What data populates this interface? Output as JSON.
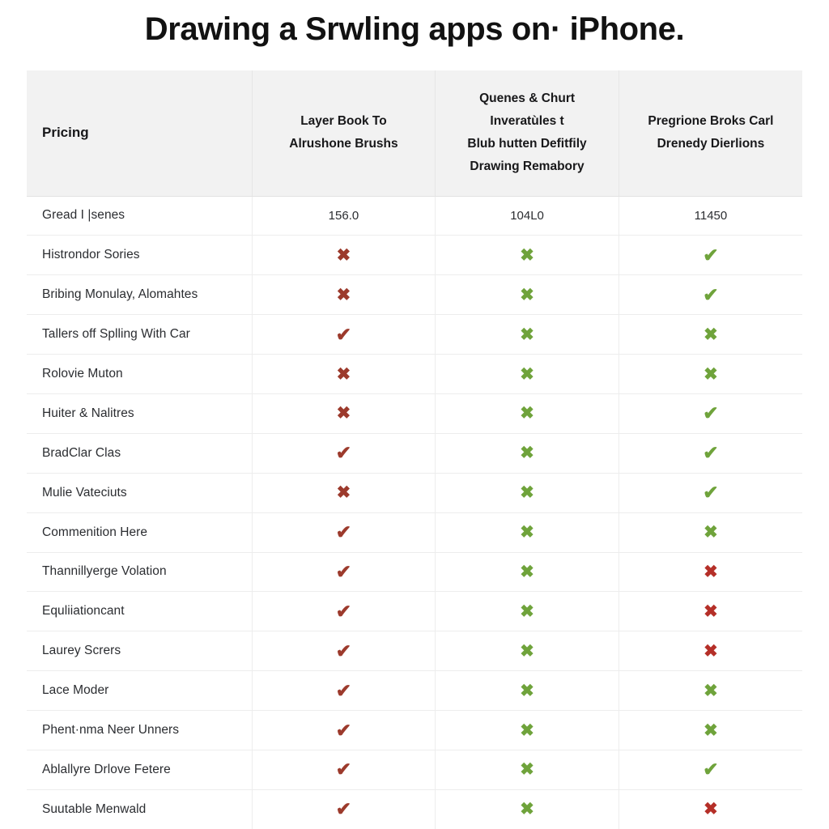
{
  "page": {
    "title": "Drawing a Srwling apps on· iPhone.",
    "background_color": "#ffffff"
  },
  "colors": {
    "header_background": "#f2f2f2",
    "row_border": "#ededed",
    "text": "#24262a",
    "mark_dark_red": "#9c3a2c",
    "mark_bright_red": "#b52f28",
    "mark_green": "#6fa33b"
  },
  "table": {
    "headers": {
      "feature_column": "Pricing",
      "columns": [
        {
          "lines": [
            "Layer Book To",
            "Alrushone Brushs"
          ]
        },
        {
          "lines": [
            "Quenes & Churt",
            "Inveratùles t",
            "Blub hutten Defitfily",
            "Drawing Remabory"
          ]
        },
        {
          "lines": [
            "Pregrione Broks Carl",
            "Drenedy Dierlions"
          ]
        }
      ]
    },
    "rows": [
      {
        "label": "Gread I |senes",
        "cells": [
          {
            "type": "value",
            "text": "156.0"
          },
          {
            "type": "value",
            "text": "104L0"
          },
          {
            "type": "value",
            "text": "11450"
          }
        ]
      },
      {
        "label": "Histrondor Sories",
        "cells": [
          {
            "type": "cross",
            "glyph": "✖",
            "color": "dark-red"
          },
          {
            "type": "cross",
            "glyph": "✖",
            "color": "green"
          },
          {
            "type": "check",
            "glyph": "✔",
            "color": "green"
          }
        ]
      },
      {
        "label": "Bribing Monulay, Alomahtes",
        "cells": [
          {
            "type": "cross",
            "glyph": "✖",
            "color": "dark-red"
          },
          {
            "type": "cross",
            "glyph": "✖",
            "color": "green"
          },
          {
            "type": "check",
            "glyph": "✔",
            "color": "green"
          }
        ]
      },
      {
        "label": "Tallers off Splling With Car",
        "cells": [
          {
            "type": "check",
            "glyph": "✔",
            "color": "dark-red"
          },
          {
            "type": "cross",
            "glyph": "✖",
            "color": "green"
          },
          {
            "type": "cross",
            "glyph": "✖",
            "color": "green"
          }
        ]
      },
      {
        "label": "Rolovie Muton",
        "cells": [
          {
            "type": "cross",
            "glyph": "✖",
            "color": "dark-red"
          },
          {
            "type": "cross",
            "glyph": "✖",
            "color": "green"
          },
          {
            "type": "cross",
            "glyph": "✖",
            "color": "green"
          }
        ]
      },
      {
        "label": "Huiter & Nalitres",
        "cells": [
          {
            "type": "cross",
            "glyph": "✖",
            "color": "dark-red"
          },
          {
            "type": "cross",
            "glyph": "✖",
            "color": "green"
          },
          {
            "type": "check",
            "glyph": "✔",
            "color": "green"
          }
        ]
      },
      {
        "label": "BradClar Clas",
        "cells": [
          {
            "type": "check",
            "glyph": "✔",
            "color": "dark-red"
          },
          {
            "type": "cross",
            "glyph": "✖",
            "color": "green"
          },
          {
            "type": "check",
            "glyph": "✔",
            "color": "green"
          }
        ]
      },
      {
        "label": "Mulie Vateciuts",
        "cells": [
          {
            "type": "cross",
            "glyph": "✖",
            "color": "dark-red"
          },
          {
            "type": "cross",
            "glyph": "✖",
            "color": "green"
          },
          {
            "type": "check",
            "glyph": "✔",
            "color": "green"
          }
        ]
      },
      {
        "label": "Commenition Here",
        "cells": [
          {
            "type": "check",
            "glyph": "✔",
            "color": "dark-red"
          },
          {
            "type": "cross",
            "glyph": "✖",
            "color": "green"
          },
          {
            "type": "cross",
            "glyph": "✖",
            "color": "green"
          }
        ]
      },
      {
        "label": "Thannillyerge Volation",
        "cells": [
          {
            "type": "check",
            "glyph": "✔",
            "color": "dark-red"
          },
          {
            "type": "cross",
            "glyph": "✖",
            "color": "green"
          },
          {
            "type": "cross",
            "glyph": "✖",
            "color": "bright-red"
          }
        ]
      },
      {
        "label": "Equliiationcant",
        "cells": [
          {
            "type": "check",
            "glyph": "✔",
            "color": "dark-red"
          },
          {
            "type": "cross",
            "glyph": "✖",
            "color": "green"
          },
          {
            "type": "cross",
            "glyph": "✖",
            "color": "bright-red"
          }
        ]
      },
      {
        "label": "Laurey Scrers",
        "cells": [
          {
            "type": "check",
            "glyph": "✔",
            "color": "dark-red"
          },
          {
            "type": "cross",
            "glyph": "✖",
            "color": "green"
          },
          {
            "type": "cross",
            "glyph": "✖",
            "color": "bright-red"
          }
        ]
      },
      {
        "label": "Lace Moder",
        "cells": [
          {
            "type": "check",
            "glyph": "✔",
            "color": "dark-red"
          },
          {
            "type": "cross",
            "glyph": "✖",
            "color": "green"
          },
          {
            "type": "cross",
            "glyph": "✖",
            "color": "green"
          }
        ]
      },
      {
        "label": "Phent·nma Neer Unners",
        "cells": [
          {
            "type": "check",
            "glyph": "✔",
            "color": "dark-red"
          },
          {
            "type": "cross",
            "glyph": "✖",
            "color": "green"
          },
          {
            "type": "cross",
            "glyph": "✖",
            "color": "green"
          }
        ]
      },
      {
        "label": "Ablallyre Drlove Fetere",
        "cells": [
          {
            "type": "check",
            "glyph": "✔",
            "color": "dark-red"
          },
          {
            "type": "cross",
            "glyph": "✖",
            "color": "green"
          },
          {
            "type": "check",
            "glyph": "✔",
            "color": "green"
          }
        ]
      },
      {
        "label": "Suutable Menwald",
        "cells": [
          {
            "type": "check",
            "glyph": "✔",
            "color": "dark-red"
          },
          {
            "type": "cross",
            "glyph": "✖",
            "color": "green"
          },
          {
            "type": "cross",
            "glyph": "✖",
            "color": "bright-red"
          }
        ]
      }
    ]
  }
}
